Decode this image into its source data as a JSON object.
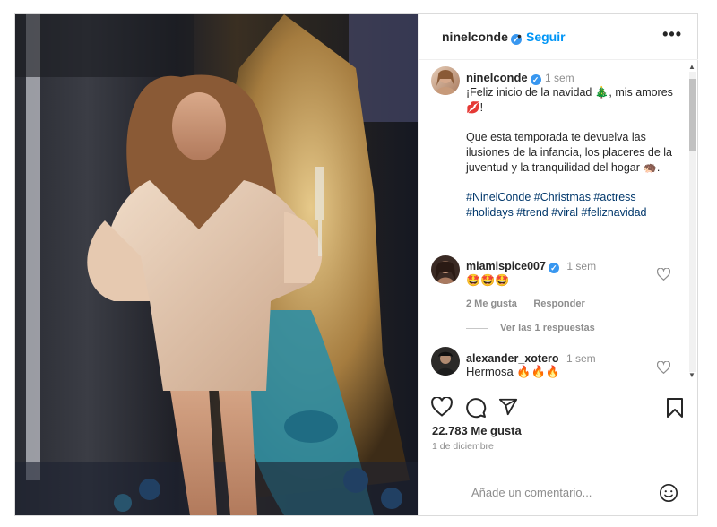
{
  "post": {
    "author": "ninelconde",
    "follow_label": "Seguir",
    "more_label": "•••",
    "verified_mark": "✓"
  },
  "caption": {
    "author": "ninelconde",
    "time": "1 sem",
    "line1": "¡Feliz inicio de la navidad 🎄, mis amores 💋!",
    "line2": "Que esta temporada te devuelva las ilusiones de la infancia, los placeres de la juventud y la tranquilidad del hogar 🦔.",
    "hashtags": "#NinelConde #Christmas #actress #holidays #trend #viral #feliznavidad"
  },
  "comments": [
    {
      "user": "miamispice007",
      "time": "1 sem",
      "text": "🤩🤩🤩",
      "likes": "2 Me gusta",
      "reply": "Responder",
      "view_replies": "Ver las 1 respuestas"
    },
    {
      "user": "alexander_xotero",
      "time": "1 sem",
      "text": "Hermosa 🔥🔥🔥"
    }
  ],
  "likes_count": "22.783 Me gusta",
  "date": "1 de diciembre",
  "add_comment_placeholder": "Añade un comentario...",
  "icons": {
    "like": "heart-icon",
    "comment": "comment-icon",
    "share": "paper-plane-icon",
    "save": "bookmark-icon",
    "emoji": "smiley-icon",
    "more": "more-options-icon"
  },
  "colors": {
    "accent": "#0095f6",
    "verified": "#3897f0",
    "text": "#262626",
    "muted": "#8e8e8e",
    "hashtag": "#00376b"
  }
}
